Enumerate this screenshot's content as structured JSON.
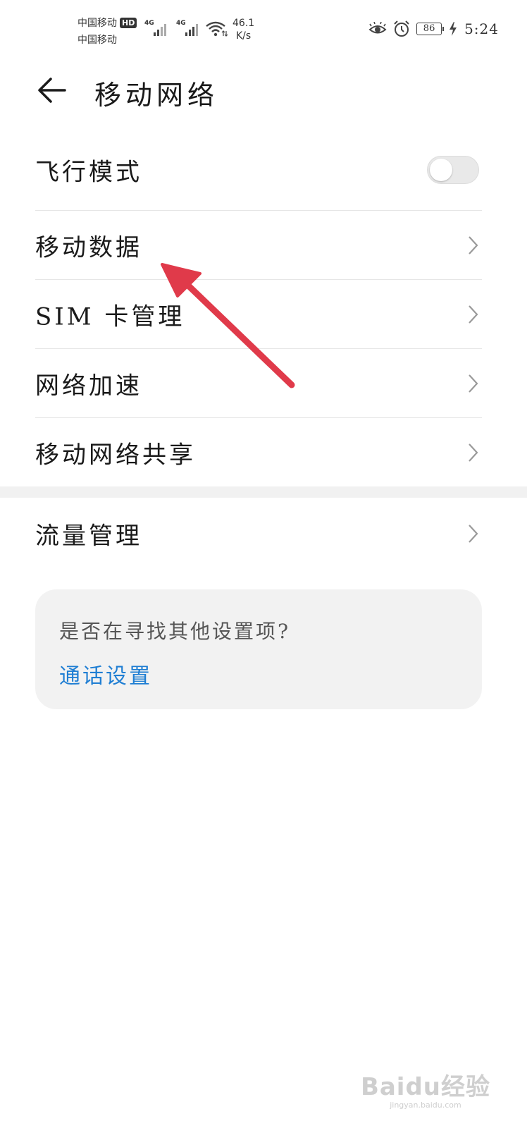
{
  "status_bar": {
    "carrier_1": "中国移动",
    "carrier_2": "中国移动",
    "hd_badge": "HD",
    "sim1_network": "4G",
    "sim2_network": "4G",
    "net_speed_value": "46.1",
    "net_speed_unit": "K/s",
    "battery_level": "86",
    "time": "5:24",
    "icons": [
      "eye-comfort-icon",
      "alarm-icon",
      "battery-icon",
      "charging-icon"
    ]
  },
  "header": {
    "title": "移动网络",
    "back_icon": "arrow-left-icon"
  },
  "settings": {
    "airplane_mode": {
      "label": "飞行模式",
      "enabled": false
    },
    "items": [
      {
        "label": "移动数据"
      },
      {
        "label": "SIM 卡管理"
      },
      {
        "label": "网络加速"
      },
      {
        "label": "移动网络共享"
      }
    ],
    "data_usage": {
      "label": "流量管理"
    }
  },
  "suggestion": {
    "question": "是否在寻找其他设置项?",
    "link": "通话设置"
  },
  "annotation": {
    "color": "#e03a4a"
  },
  "watermark": {
    "brand": "Baidu经验",
    "url": "jingyan.baidu.com"
  },
  "colors": {
    "accent": "#1f7ed3",
    "background": "#ffffff"
  }
}
